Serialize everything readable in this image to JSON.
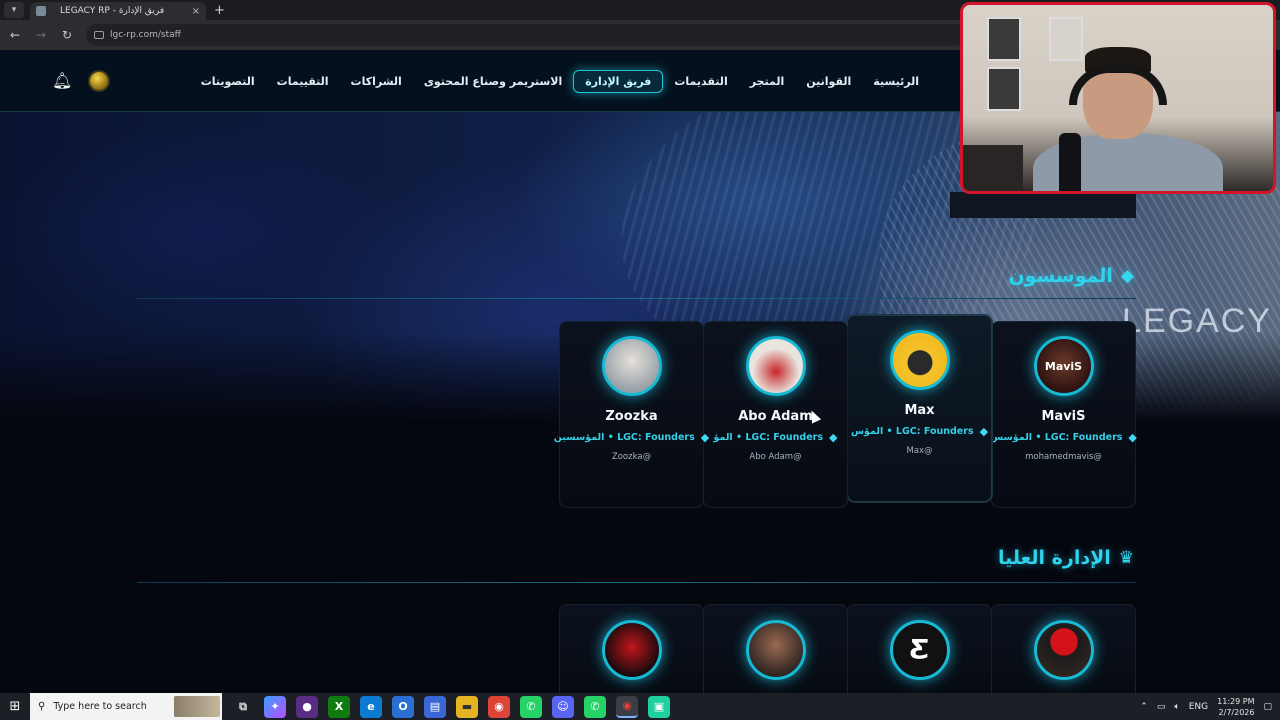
{
  "browser": {
    "tab_title": "LEGACY RP - فريق الإدارة",
    "tab_close": "×",
    "new_tab": "+",
    "url": "lgc-rp.com/staff"
  },
  "site": {
    "nav": [
      {
        "label": "الرئيسية"
      },
      {
        "label": "القوانين"
      },
      {
        "label": "المتجر"
      },
      {
        "label": "التقديمات"
      },
      {
        "label": "فريق الإدارة",
        "active": true
      },
      {
        "label": "الاستريمر وصناع المحتوى"
      },
      {
        "label": "الشراكات"
      },
      {
        "label": "التقييمات"
      },
      {
        "label": "التصويتات"
      }
    ],
    "hero_watermark": "LEGACY",
    "sections": {
      "founders_title": "الموسسون",
      "upper_admin_title": "الإدارة العليا"
    },
    "founders": [
      {
        "name": "MaviS",
        "role": "LGC: Founders • المؤسس",
        "handle": "mohamedmavis@",
        "avatar_text": "MaviS"
      },
      {
        "name": "Max",
        "role": "LGC: Founders • المؤس",
        "handle": "Max@",
        "avatar_text": ""
      },
      {
        "name": "Abo Adam",
        "role": "LGC: Founders • المؤ",
        "handle": "Abo Adam@",
        "avatar_text": ""
      },
      {
        "name": "Zoozka",
        "role": "LGC: Founders • المؤسسين",
        "handle": "Zoozka@",
        "avatar_text": ""
      }
    ],
    "upper_admin": [
      {
        "avatar_text": ""
      },
      {
        "avatar_text": "Ƹ"
      },
      {
        "avatar_text": ""
      },
      {
        "avatar_text": ""
      }
    ]
  },
  "taskbar": {
    "search_placeholder": "Type here to search",
    "language": "ENG",
    "time": "11:29 PM",
    "date": "2/7/2026"
  },
  "colors": {
    "accent": "#2fd3ee",
    "background": "#05070f",
    "webcam_border": "#d3152b"
  }
}
